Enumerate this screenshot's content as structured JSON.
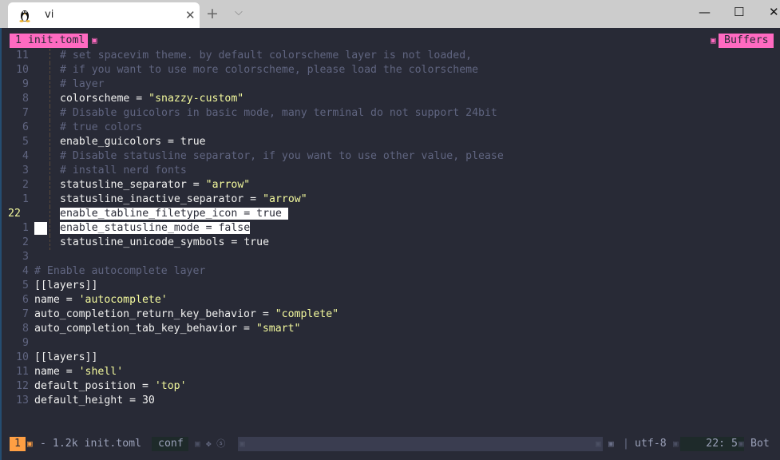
{
  "window": {
    "tab_title": "vi",
    "tab_icon": "linux-tux-icon",
    "close_tab": "✕",
    "new_tab": "+",
    "tab_dropdown": "⌵",
    "minimize": "—",
    "maximize": "☐",
    "close": "✕"
  },
  "tabline": {
    "buffer_tab": "1 init.toml",
    "separator": "▣",
    "buffers_label": "Buffers"
  },
  "lines": [
    {
      "num": "11",
      "type": "comment",
      "text": "# set spacevim theme. by default colorscheme layer is not loaded,"
    },
    {
      "num": "10",
      "type": "comment",
      "text": "# if you want to use more colorscheme, please load the colorscheme"
    },
    {
      "num": "9",
      "type": "comment",
      "text": "# layer"
    },
    {
      "num": "8",
      "type": "kv",
      "key": "colorscheme = ",
      "value": "\"snazzy-custom\""
    },
    {
      "num": "7",
      "type": "comment",
      "text": "# Disable guicolors in basic mode, many terminal do not support 24bit"
    },
    {
      "num": "6",
      "type": "comment",
      "text": "# true colors"
    },
    {
      "num": "5",
      "type": "plain",
      "text": "enable_guicolors = true"
    },
    {
      "num": "4",
      "type": "comment",
      "text": "# Disable statusline separator, if you want to use other value, please"
    },
    {
      "num": "3",
      "type": "comment",
      "text": "# install nerd fonts"
    },
    {
      "num": "2",
      "type": "kv",
      "key": "statusline_separator = ",
      "value": "\"arrow\""
    },
    {
      "num": "1",
      "type": "kv",
      "key": "statusline_inactive_separator = ",
      "value": "\"arrow\""
    },
    {
      "num": "22",
      "type": "selected",
      "text": "enable_tabline_filetype_icon = true "
    },
    {
      "num": "1",
      "type": "selected-cursor",
      "text": "enable_statusline_mode = false"
    },
    {
      "num": "2",
      "type": "plain",
      "text": "statusline_unicode_symbols = true"
    },
    {
      "num": "3",
      "type": "empty",
      "text": ""
    },
    {
      "num": "4",
      "type": "comment-flush",
      "text": "# Enable autocomplete layer"
    },
    {
      "num": "5",
      "type": "plain-flush",
      "text": "[[layers]]"
    },
    {
      "num": "6",
      "type": "kv-flush",
      "key": "name = ",
      "value": "'autocomplete'"
    },
    {
      "num": "7",
      "type": "kv-flush",
      "key": "auto_completion_return_key_behavior = ",
      "value": "\"complete\""
    },
    {
      "num": "8",
      "type": "kv-flush",
      "key": "auto_completion_tab_key_behavior = ",
      "value": "\"smart\""
    },
    {
      "num": "9",
      "type": "empty",
      "text": ""
    },
    {
      "num": "10",
      "type": "plain-flush",
      "text": "[[layers]]"
    },
    {
      "num": "11",
      "type": "kv-flush",
      "key": "name = ",
      "value": "'shell'"
    },
    {
      "num": "12",
      "type": "kv-flush",
      "key": "default_position = ",
      "value": "'top'"
    },
    {
      "num": "13",
      "type": "plain-flush",
      "text": "default_height = 30"
    }
  ],
  "statusline": {
    "mode": "1",
    "glyph": "▣",
    "file_info": "- 1.2k init.toml",
    "filetype": "conf",
    "icons": "✥ ⓢ",
    "separator_bar": "|",
    "encoding": "utf-8",
    "position": "22:  5",
    "scroll": "Bot"
  },
  "colors": {
    "background": "#282a36",
    "accent_pink": "#ff6ac1",
    "mode_orange": "#ff9f43",
    "string_yellow": "#f3f99d",
    "comment_gray": "#606580"
  }
}
